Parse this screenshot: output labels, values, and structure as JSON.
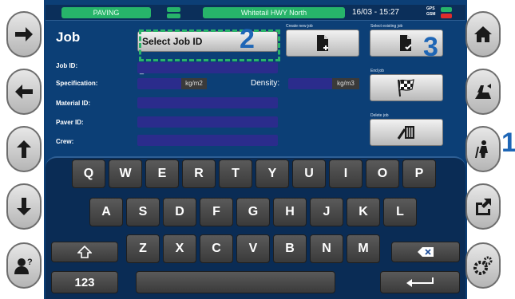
{
  "topbar": {
    "mode": "PAVING",
    "road": "Whitetail HWY North",
    "datetime": "16/03 - 15:27",
    "gps_label": "GPS",
    "gsm_label": "GSM"
  },
  "form": {
    "title": "Job",
    "select_job_value": "Select Job ID",
    "job_id_label": "Job ID:",
    "job_id_value": "_",
    "spec_label": "Specification:",
    "spec_unit": "kg/m2",
    "density_label": "Density:",
    "density_unit": "kg/m3",
    "material_label": "Material ID:",
    "paver_label": "Paver ID:",
    "crew_label": "Crew:"
  },
  "actions": {
    "create_label": "Create new job",
    "select_existing_label": "Select existing job",
    "end_label": "End job",
    "delete_label": "Delete job"
  },
  "annotations": [
    "1",
    "2",
    "3"
  ],
  "keyboard": {
    "row1": [
      "Q",
      "W",
      "E",
      "R",
      "T",
      "Y",
      "U",
      "I",
      "O",
      "P"
    ],
    "row2": [
      "A",
      "S",
      "D",
      "F",
      "G",
      "H",
      "J",
      "K",
      "L"
    ],
    "row3": [
      "Z",
      "X",
      "C",
      "V",
      "B",
      "N",
      "M"
    ],
    "numbers_label": "123"
  },
  "side_left": [
    "arrow-right-icon",
    "arrow-left-icon",
    "arrow-up-icon",
    "arrow-down-icon",
    "help-user-icon"
  ],
  "side_right": [
    "home-icon",
    "paver-icon",
    "worker-icon",
    "export-icon",
    "settings-icon"
  ]
}
